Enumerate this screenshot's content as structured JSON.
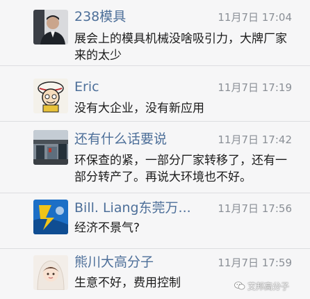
{
  "comments": [
    {
      "name": "238模具",
      "time": "11月7日 17:04",
      "text": "展会上的模具机械没啥吸引力，大牌厂家来的太少",
      "avatar_icon": "avatar-man-suit-icon"
    },
    {
      "name": "Eric",
      "time": "11月7日 17:19",
      "text": "没有大企业，没有新应用",
      "avatar_icon": "avatar-cartoon-icon"
    },
    {
      "name": "还有什么话要说",
      "time": "11月7日 17:42",
      "text": "环保查的紧，一部分厂家转移了，还有一部分转产了。再说大环境也不好。",
      "avatar_icon": "avatar-factory-icon"
    },
    {
      "name": "Bill. Liang东莞万...",
      "time": "11月7日 17:56",
      "text": "经济不景气?",
      "avatar_icon": "avatar-blue-logo-icon"
    },
    {
      "name": "熊川大高分子",
      "time": "11月7日 17:59",
      "text": "生意不好，费用控制",
      "avatar_icon": "avatar-girl-icon"
    }
  ],
  "watermark": {
    "text": "艾邦高分子",
    "icon": "wechat-icon"
  },
  "colors": {
    "name": "#4d6f99",
    "time": "#8a8f96",
    "text": "#1b1b1b",
    "background": "#f6f6f7",
    "divider": "#dcdde0"
  }
}
